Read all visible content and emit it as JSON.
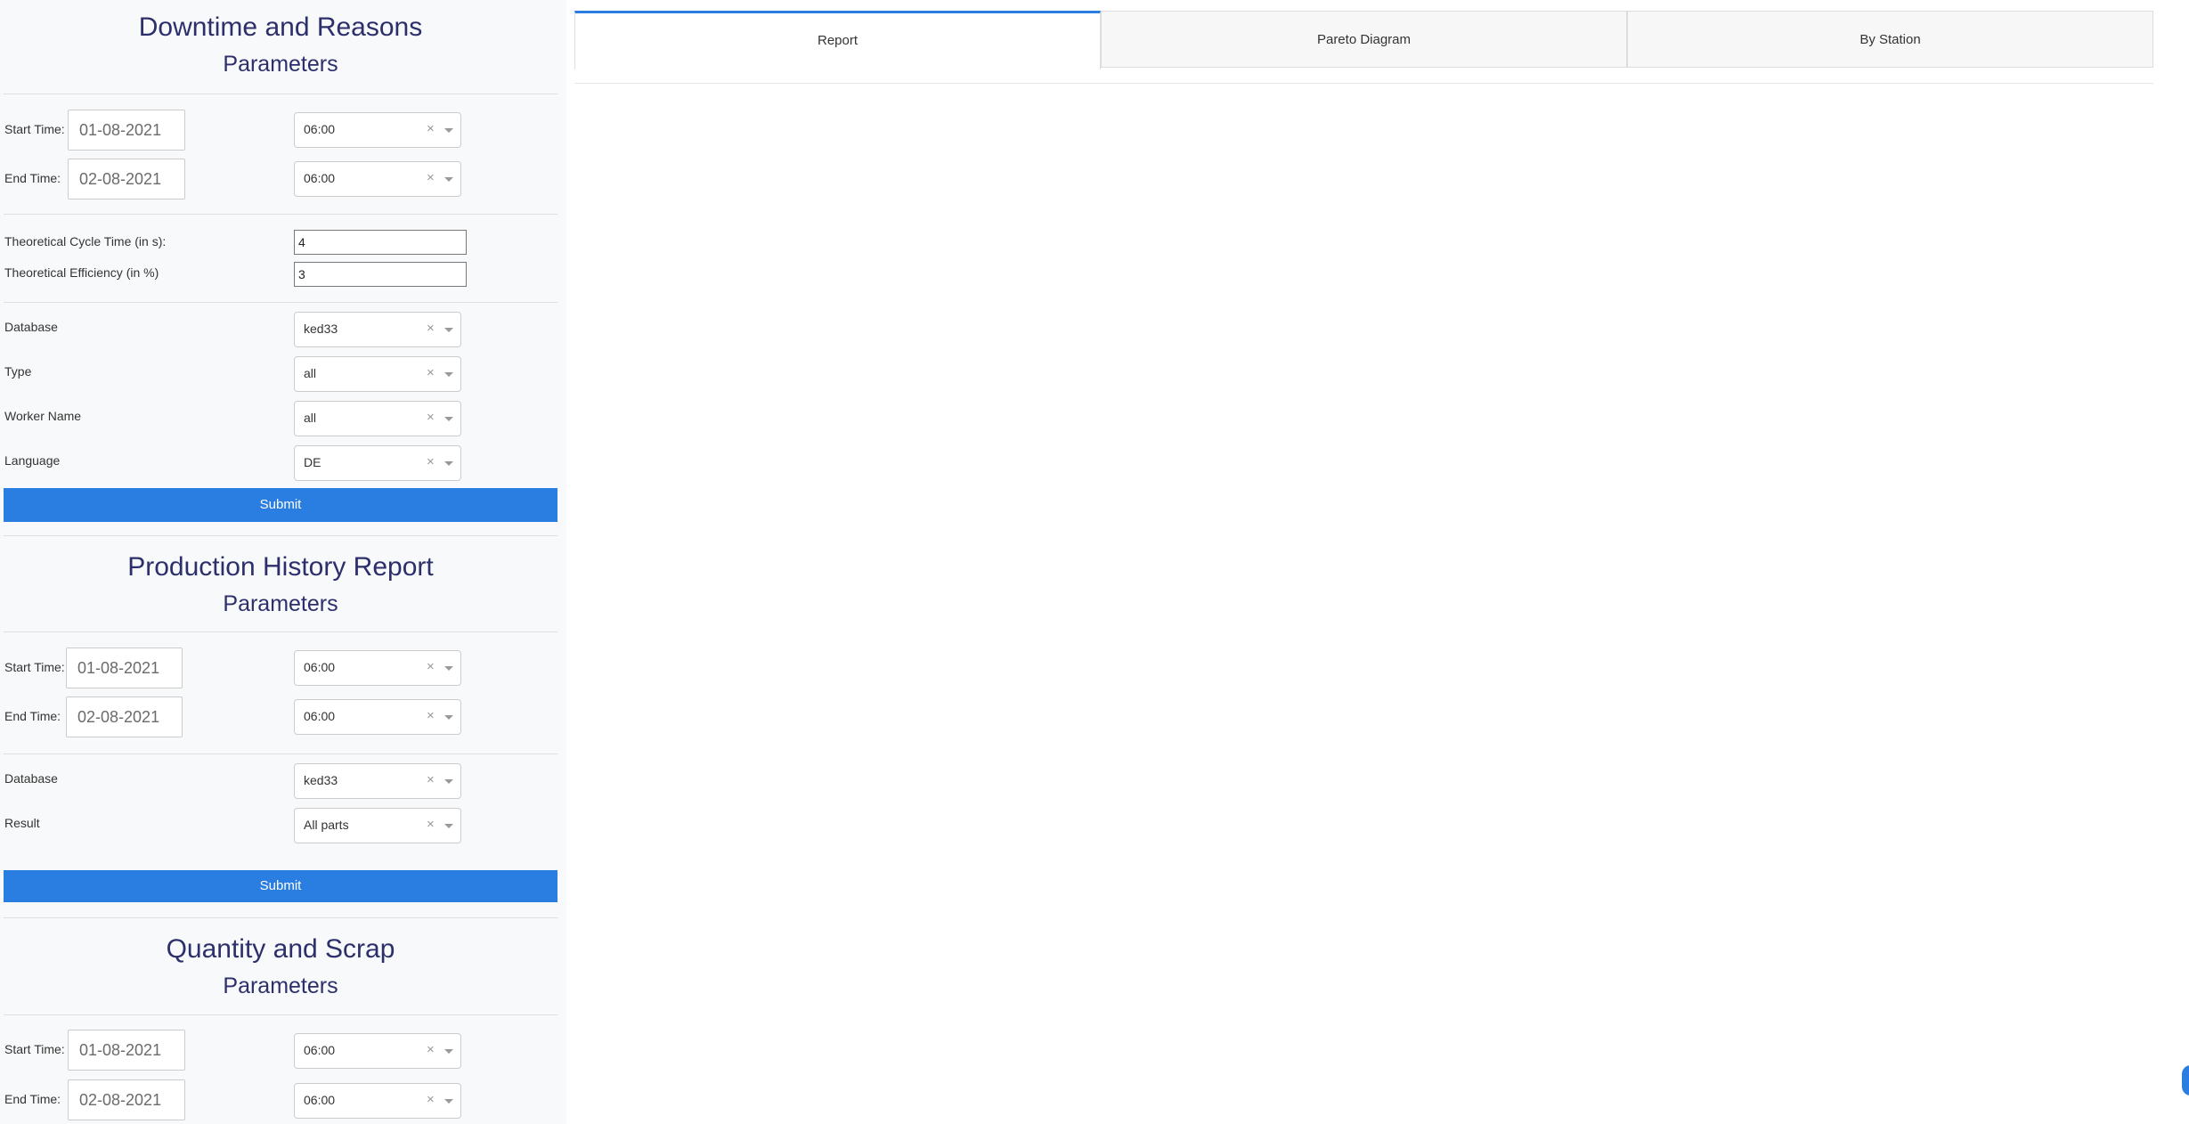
{
  "sections": [
    {
      "title": "Downtime and Reasons",
      "subtitle": "Parameters",
      "start_label": "Start Time:",
      "start_date": "01-08-2021",
      "start_hour": "06:00",
      "end_label": "End Time:",
      "end_date": "02-08-2021",
      "end_hour": "06:00",
      "cycle_label": "Theoretical Cycle Time (in s):",
      "cycle_value": "4",
      "efficiency_label": "Theoretical Efficiency (in %)",
      "efficiency_value": "3",
      "database_label": "Database",
      "database_value": "ked33",
      "type_label": "Type",
      "type_value": "all",
      "worker_label": "Worker Name",
      "worker_value": "all",
      "language_label": "Language",
      "language_value": "DE",
      "submit_label": "Submit"
    },
    {
      "title": "Production History Report",
      "subtitle": "Parameters",
      "start_label": "Start Time:",
      "start_date": "01-08-2021",
      "start_hour": "06:00",
      "end_label": "End Time:",
      "end_date": "02-08-2021",
      "end_hour": "06:00",
      "database_label": "Database",
      "database_value": "ked33",
      "result_label": "Result",
      "result_value": "All parts",
      "submit_label": "Submit"
    },
    {
      "title": "Quantity and Scrap",
      "subtitle": "Parameters",
      "start_label": "Start Time:",
      "start_date": "01-08-2021",
      "start_hour": "06:00",
      "end_label": "End Time:",
      "end_date": "02-08-2021",
      "end_hour": "06:00"
    }
  ],
  "clear_glyph": "×",
  "tabs": [
    {
      "label": "Report",
      "active": true
    },
    {
      "label": "Pareto Diagram",
      "active": false
    },
    {
      "label": "By Station",
      "active": false
    }
  ],
  "colors": {
    "accent": "#2a7de1",
    "title": "#2c2f6b",
    "sidebar_bg": "#f8f9fa"
  }
}
